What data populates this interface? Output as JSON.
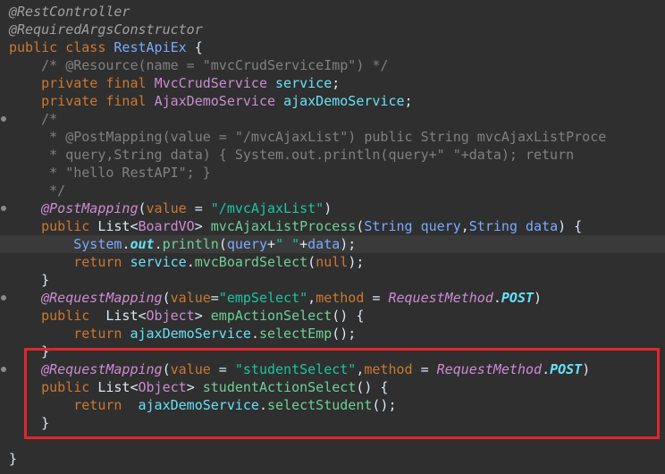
{
  "code": {
    "lines": [
      {
        "tokens": [
          {
            "t": "@RestController",
            "c": "annotation"
          }
        ]
      },
      {
        "tokens": [
          {
            "t": "@RequiredArgsConstructor",
            "c": "annotation"
          }
        ]
      },
      {
        "tokens": [
          {
            "t": "public ",
            "c": "keyword"
          },
          {
            "t": "class ",
            "c": "keyword"
          },
          {
            "t": "RestApiEx",
            "c": "param"
          },
          {
            "t": " {",
            "c": "plain"
          }
        ]
      },
      {
        "tokens": [
          {
            "t": "    /* @Resource(name = \"mvcCrudServiceImp\") */",
            "c": "comment"
          }
        ]
      },
      {
        "tokens": [
          {
            "t": "    private ",
            "c": "keyword"
          },
          {
            "t": "final ",
            "c": "keyword"
          },
          {
            "t": "MvcCrudService ",
            "c": "type"
          },
          {
            "t": "service",
            "c": "field"
          },
          {
            "t": ";",
            "c": "plain"
          }
        ]
      },
      {
        "tokens": [
          {
            "t": "    private ",
            "c": "keyword"
          },
          {
            "t": "final ",
            "c": "keyword"
          },
          {
            "t": "AjaxDemoService ",
            "c": "type"
          },
          {
            "t": "ajaxDemoService",
            "c": "field"
          },
          {
            "t": ";",
            "c": "plain"
          }
        ]
      },
      {
        "tokens": [
          {
            "t": "    /*",
            "c": "comment"
          }
        ],
        "fold": true
      },
      {
        "tokens": [
          {
            "t": "     * @PostMapping(value = \"/mvcAjaxList\") public String mvcAjaxListProce",
            "c": "comment"
          }
        ]
      },
      {
        "tokens": [
          {
            "t": "     * query,String data) { System.out.println(query+\" \"+data); return",
            "c": "comment"
          }
        ]
      },
      {
        "tokens": [
          {
            "t": "     * \"hello RestAPI\"; }",
            "c": "comment"
          }
        ]
      },
      {
        "tokens": [
          {
            "t": "     */",
            "c": "comment"
          }
        ]
      },
      {
        "tokens": [
          {
            "t": "    @PostMapping",
            "c": "anno-use"
          },
          {
            "t": "(",
            "c": "plain"
          },
          {
            "t": "value",
            "c": "keyword"
          },
          {
            "t": " = ",
            "c": "plain"
          },
          {
            "t": "\"/mvcAjaxList\"",
            "c": "string"
          },
          {
            "t": ")",
            "c": "plain"
          }
        ],
        "fold": true
      },
      {
        "tokens": [
          {
            "t": "    public ",
            "c": "keyword"
          },
          {
            "t": "List",
            "c": "plain"
          },
          {
            "t": "<",
            "c": "plain"
          },
          {
            "t": "BoardVO",
            "c": "type"
          },
          {
            "t": "> ",
            "c": "plain"
          },
          {
            "t": "mvcAjaxListProcess",
            "c": "method"
          },
          {
            "t": "(",
            "c": "plain"
          },
          {
            "t": "String ",
            "c": "param"
          },
          {
            "t": "query",
            "c": "param"
          },
          {
            "t": ",",
            "c": "plain"
          },
          {
            "t": "String ",
            "c": "param"
          },
          {
            "t": "data",
            "c": "param"
          },
          {
            "t": ") {",
            "c": "plain"
          }
        ]
      },
      {
        "tokens": [
          {
            "t": "        System",
            "c": "param"
          },
          {
            "t": ".",
            "c": "plain"
          },
          {
            "t": "out",
            "c": "static"
          },
          {
            "t": ".",
            "c": "plain"
          },
          {
            "t": "println",
            "c": "method"
          },
          {
            "t": "(",
            "c": "plain"
          },
          {
            "t": "query",
            "c": "param"
          },
          {
            "t": "+",
            "c": "plain"
          },
          {
            "t": "\" \"",
            "c": "string"
          },
          {
            "t": "+",
            "c": "plain"
          },
          {
            "t": "data",
            "c": "param"
          },
          {
            "t": ");",
            "c": "plain"
          }
        ],
        "current": true
      },
      {
        "tokens": [
          {
            "t": "        return ",
            "c": "keyword"
          },
          {
            "t": "service",
            "c": "field"
          },
          {
            "t": ".",
            "c": "plain"
          },
          {
            "t": "mvcBoardSelect",
            "c": "method"
          },
          {
            "t": "(",
            "c": "plain"
          },
          {
            "t": "null",
            "c": "keyword"
          },
          {
            "t": ");",
            "c": "plain"
          }
        ]
      },
      {
        "tokens": [
          {
            "t": "    }",
            "c": "plain"
          }
        ]
      },
      {
        "tokens": [
          {
            "t": "    @RequestMapping",
            "c": "anno-use"
          },
          {
            "t": "(",
            "c": "plain"
          },
          {
            "t": "value",
            "c": "keyword"
          },
          {
            "t": "=",
            "c": "plain"
          },
          {
            "t": "\"empSelect\"",
            "c": "string"
          },
          {
            "t": ",",
            "c": "plain"
          },
          {
            "t": "method",
            "c": "keyword"
          },
          {
            "t": " = ",
            "c": "plain"
          },
          {
            "t": "RequestMethod",
            "c": "enum"
          },
          {
            "t": ".",
            "c": "plain"
          },
          {
            "t": "POST",
            "c": "static"
          },
          {
            "t": ")",
            "c": "plain"
          }
        ],
        "fold": true
      },
      {
        "tokens": [
          {
            "t": "    public  ",
            "c": "keyword"
          },
          {
            "t": "List",
            "c": "plain"
          },
          {
            "t": "<",
            "c": "plain"
          },
          {
            "t": "Object",
            "c": "type"
          },
          {
            "t": "> ",
            "c": "plain"
          },
          {
            "t": "empActionSelect",
            "c": "method"
          },
          {
            "t": "() {",
            "c": "plain"
          }
        ]
      },
      {
        "tokens": [
          {
            "t": "        return ",
            "c": "keyword"
          },
          {
            "t": "ajaxDemoService",
            "c": "field"
          },
          {
            "t": ".",
            "c": "plain"
          },
          {
            "t": "selectEmp",
            "c": "method"
          },
          {
            "t": "();",
            "c": "plain"
          }
        ]
      },
      {
        "tokens": [
          {
            "t": "    }",
            "c": "plain"
          }
        ]
      },
      {
        "tokens": [
          {
            "t": "    @RequestMapping",
            "c": "anno-use"
          },
          {
            "t": "(",
            "c": "plain"
          },
          {
            "t": "value",
            "c": "keyword"
          },
          {
            "t": " = ",
            "c": "plain"
          },
          {
            "t": "\"studentSelect\"",
            "c": "string"
          },
          {
            "t": ",",
            "c": "plain"
          },
          {
            "t": "method",
            "c": "keyword"
          },
          {
            "t": " = ",
            "c": "plain"
          },
          {
            "t": "RequestMethod",
            "c": "enum"
          },
          {
            "t": ".",
            "c": "plain"
          },
          {
            "t": "POST",
            "c": "static"
          },
          {
            "t": ")",
            "c": "plain"
          }
        ],
        "fold": true
      },
      {
        "tokens": [
          {
            "t": "    public ",
            "c": "keyword"
          },
          {
            "t": "List",
            "c": "plain"
          },
          {
            "t": "<",
            "c": "plain"
          },
          {
            "t": "Object",
            "c": "type"
          },
          {
            "t": "> ",
            "c": "plain"
          },
          {
            "t": "studentActionSelect",
            "c": "method"
          },
          {
            "t": "() {",
            "c": "plain"
          }
        ]
      },
      {
        "tokens": [
          {
            "t": "        return  ",
            "c": "keyword"
          },
          {
            "t": "ajaxDemoService",
            "c": "field"
          },
          {
            "t": ".",
            "c": "plain"
          },
          {
            "t": "selectStudent",
            "c": "method"
          },
          {
            "t": "();",
            "c": "plain"
          }
        ]
      },
      {
        "tokens": [
          {
            "t": "    }",
            "c": "plain"
          }
        ]
      },
      {
        "tokens": [
          {
            "t": "",
            "c": "plain"
          }
        ]
      },
      {
        "tokens": [
          {
            "t": "}",
            "c": "plain"
          }
        ]
      }
    ]
  },
  "colors": {
    "background": "#2f2f2f",
    "highlight_box": "#e0262b"
  }
}
